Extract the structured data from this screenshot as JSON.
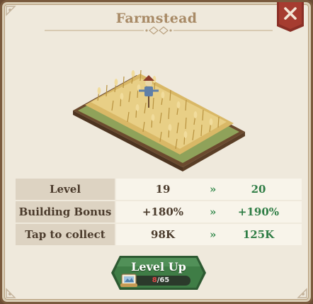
{
  "dialog": {
    "title": "Farmstead"
  },
  "stats": [
    {
      "label": "Level",
      "current": "19",
      "next": "20"
    },
    {
      "label": "Building Bonus",
      "current": "+180%",
      "next": "+190%"
    },
    {
      "label": "Tap to collect",
      "current": "98K",
      "next": "125K"
    }
  ],
  "upgrade": {
    "button_label": "Level Up",
    "cost_have": "8",
    "cost_separator": "/",
    "cost_need": "65"
  },
  "arrow_glyph": "»",
  "colors": {
    "panel_bg": "#efe9dc",
    "frame": "#7a5a3d",
    "close_button": "#9c3b2e",
    "level_up_button": "#3f7d46",
    "increase_text": "#2f7d45",
    "insufficient_text": "#e04848"
  }
}
